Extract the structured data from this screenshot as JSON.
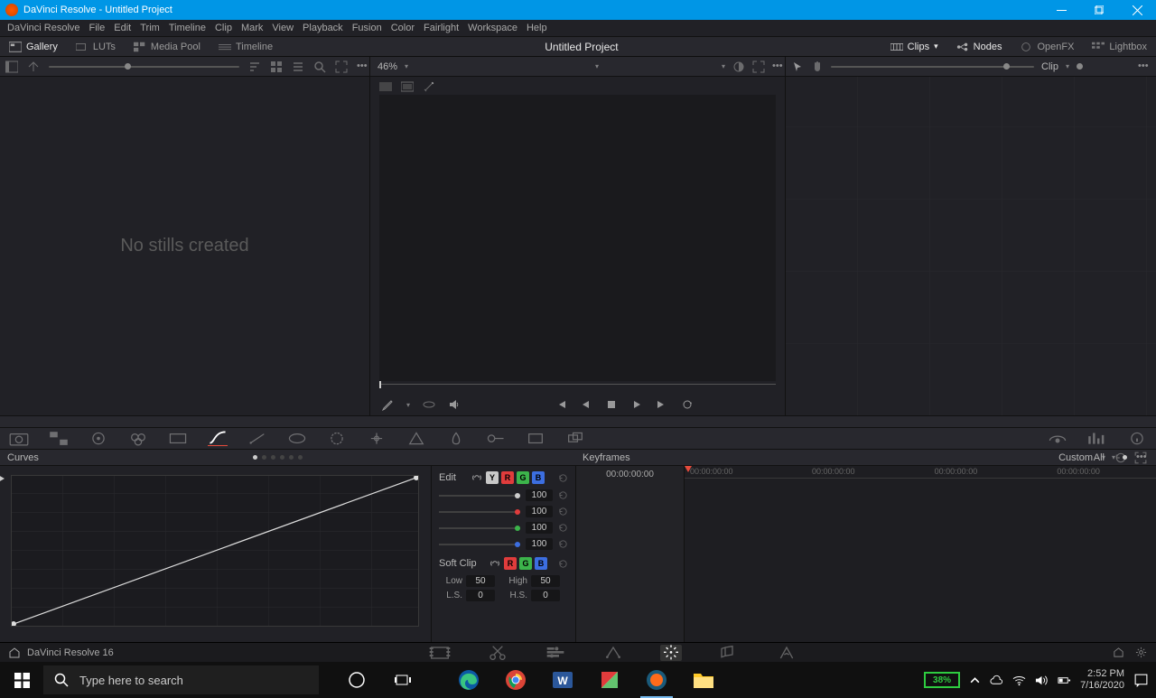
{
  "window": {
    "title": "DaVinci Resolve - Untitled Project"
  },
  "menu": [
    "DaVinci Resolve",
    "File",
    "Edit",
    "Trim",
    "Timeline",
    "Clip",
    "Mark",
    "View",
    "Playback",
    "Fusion",
    "Color",
    "Fairlight",
    "Workspace",
    "Help"
  ],
  "project_title": "Untitled Project",
  "workspace_toggles": {
    "gallery": "Gallery",
    "luts": "LUTs",
    "media_pool": "Media Pool",
    "timeline": "Timeline",
    "clips": "Clips",
    "nodes": "Nodes",
    "openfx": "OpenFX",
    "lightbox": "Lightbox"
  },
  "viewer": {
    "zoom": "46%"
  },
  "gallery_empty": "No stills created",
  "node_panel_label": "Clip",
  "curves": {
    "title": "Curves",
    "mode": "Custom",
    "edit_label": "Edit",
    "channels": [
      "Y",
      "R",
      "G",
      "B"
    ],
    "intensity": {
      "lum": 100,
      "red": 100,
      "green": 100,
      "blue": 100
    },
    "softclip": {
      "label": "Soft Clip",
      "low_label": "Low",
      "low": 50.0,
      "high_label": "High",
      "high": 50.0,
      "ls_label": "L.S.",
      "ls": 0.0,
      "hs_label": "H.S.",
      "hs": 0.0
    }
  },
  "keyframes": {
    "title": "Keyframes",
    "filter": "All",
    "timecode": "00:00:00:00",
    "marks": [
      "00:00:00:00",
      "00:00:00:00",
      "00:00:00:00",
      "00:00:00:00"
    ]
  },
  "footer": {
    "app": "DaVinci Resolve 16"
  },
  "taskbar": {
    "search_placeholder": "Type here to search",
    "battery": "38%",
    "time": "2:52 PM",
    "date": "7/16/2020"
  }
}
